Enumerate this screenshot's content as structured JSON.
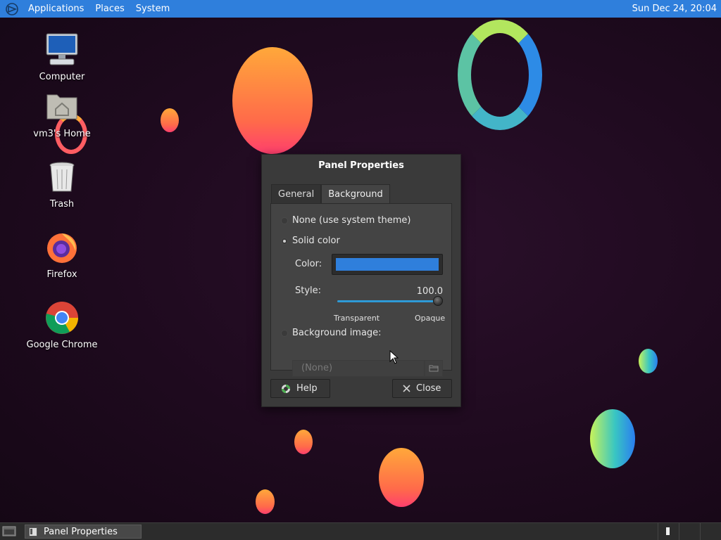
{
  "top_panel": {
    "menus": [
      "Applications",
      "Places",
      "System"
    ],
    "clock": "Sun Dec 24, 20:04"
  },
  "desktop_icons": [
    {
      "label": "Computer",
      "icon": "computer-icon"
    },
    {
      "label": "vm3's Home",
      "icon": "home-folder-icon"
    },
    {
      "label": "Trash",
      "icon": "trash-icon"
    },
    {
      "label": "Firefox",
      "icon": "firefox-icon"
    },
    {
      "label": "Google Chrome",
      "icon": "chrome-icon"
    }
  ],
  "dialog": {
    "title": "Panel Properties",
    "tabs": [
      {
        "label": "General",
        "active": false
      },
      {
        "label": "Background",
        "active": true
      }
    ],
    "options": {
      "none": "None (use system theme)",
      "solid": "Solid color",
      "image": "Background image:"
    },
    "selected_option": "solid",
    "color_label": "Color:",
    "color_value": "#2f7fdc",
    "style_label": "Style:",
    "style_value": "100.0",
    "slider_min_label": "Transparent",
    "slider_max_label": "Opaque",
    "file_chooser_value": "(None)",
    "help_label": "Help",
    "close_label": "Close"
  },
  "bottom_panel": {
    "task_label": "Panel Properties"
  },
  "colors": {
    "panel_accent": "#2f7fdc",
    "dialog_bg": "#3a3a3a"
  }
}
